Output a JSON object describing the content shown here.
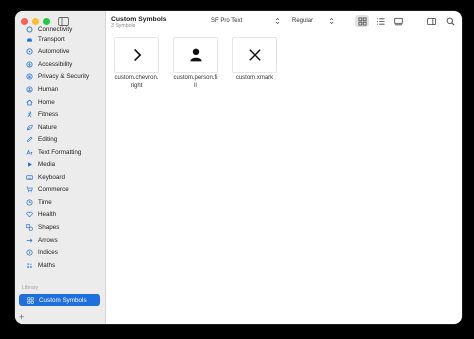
{
  "sidebar": {
    "categories": [
      {
        "label": "Connectivity",
        "icon": "connectivity-icon"
      },
      {
        "label": "Transport",
        "icon": "car-icon"
      },
      {
        "label": "Automotive",
        "icon": "steering-wheel-icon"
      },
      {
        "label": "Accessibility",
        "icon": "accessibility-icon"
      },
      {
        "label": "Privacy & Security",
        "icon": "lock-icon"
      },
      {
        "label": "Human",
        "icon": "person-icon"
      },
      {
        "label": "Home",
        "icon": "house-icon"
      },
      {
        "label": "Fitness",
        "icon": "figure-run-icon"
      },
      {
        "label": "Nature",
        "icon": "leaf-icon"
      },
      {
        "label": "Editing",
        "icon": "pencil-icon"
      },
      {
        "label": "Text Formatting",
        "icon": "textformat-icon"
      },
      {
        "label": "Media",
        "icon": "play-icon"
      },
      {
        "label": "Keyboard",
        "icon": "keyboard-icon"
      },
      {
        "label": "Commerce",
        "icon": "cart-icon"
      },
      {
        "label": "Time",
        "icon": "clock-icon"
      },
      {
        "label": "Health",
        "icon": "heart-icon"
      },
      {
        "label": "Shapes",
        "icon": "shapes-icon"
      },
      {
        "label": "Arrows",
        "icon": "arrow-icon"
      },
      {
        "label": "Indices",
        "icon": "indices-icon"
      },
      {
        "label": "Maths",
        "icon": "math-icon"
      }
    ],
    "library_label": "Library",
    "library_items": [
      {
        "label": "Custom Symbols",
        "icon": "grid-icon",
        "selected": true
      }
    ],
    "add_label": "+"
  },
  "toolbar": {
    "title": "Custom Symbols",
    "subtitle": "3 Symbols",
    "font_select": "SF Pro Text",
    "weight_select": "Regular"
  },
  "symbols": [
    {
      "name": "custom.chevron.right",
      "icon": "chevron-right-icon"
    },
    {
      "name": "custom.person.fill",
      "icon": "person-fill-icon"
    },
    {
      "name": "custom.xmark",
      "icon": "xmark-icon"
    }
  ],
  "colors": {
    "accent": "#1f6fde",
    "sidebar_bg": "#ececec",
    "close": "#ff5f57",
    "minimize": "#febc2e",
    "zoom": "#28c840"
  }
}
